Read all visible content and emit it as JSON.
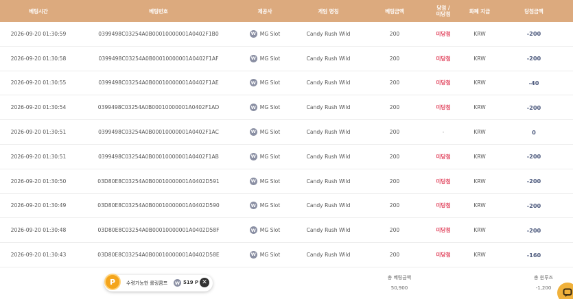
{
  "columns": {
    "time": "베팅시간",
    "id": "베팅번호",
    "vendor": "제공사",
    "game": "게임 명칭",
    "bet": "베팅금액",
    "result_line1": "당첨 /",
    "result_line2": "미당첨",
    "currency": "화폐 지급",
    "win": "당첨금액"
  },
  "rows": [
    {
      "time": "2026-09-20 01:30:59",
      "id": "0399498C03254A0B00010000001A0402F1B0",
      "vendor": "MG Slot",
      "game": "Candy Rush Wild",
      "bet": "200",
      "result": "미당첨",
      "currency": "KRW",
      "win": "-200"
    },
    {
      "time": "2026-09-20 01:30:58",
      "id": "0399498C03254A0B00010000001A0402F1AF",
      "vendor": "MG Slot",
      "game": "Candy Rush Wild",
      "bet": "200",
      "result": "미당첨",
      "currency": "KRW",
      "win": "-200"
    },
    {
      "time": "2026-09-20 01:30:55",
      "id": "0399498C03254A0B00010000001A0402F1AE",
      "vendor": "MG Slot",
      "game": "Candy Rush Wild",
      "bet": "200",
      "result": "미당첨",
      "currency": "KRW",
      "win": "-40"
    },
    {
      "time": "2026-09-20 01:30:54",
      "id": "0399498C03254A0B00010000001A0402F1AD",
      "vendor": "MG Slot",
      "game": "Candy Rush Wild",
      "bet": "200",
      "result": "미당첨",
      "currency": "KRW",
      "win": "-200"
    },
    {
      "time": "2026-09-20 01:30:51",
      "id": "0399498C03254A0B00010000001A0402F1AC",
      "vendor": "MG Slot",
      "game": "Candy Rush Wild",
      "bet": "200",
      "result": "-",
      "currency": "KRW",
      "win": "0"
    },
    {
      "time": "2026-09-20 01:30:51",
      "id": "0399498C03254A0B00010000001A0402F1AB",
      "vendor": "MG Slot",
      "game": "Candy Rush Wild",
      "bet": "200",
      "result": "미당첨",
      "currency": "KRW",
      "win": "-200"
    },
    {
      "time": "2026-09-20 01:30:50",
      "id": "03D80E8C03254A0B00010000001A0402D591",
      "vendor": "MG Slot",
      "game": "Candy Rush Wild",
      "bet": "200",
      "result": "미당첨",
      "currency": "KRW",
      "win": "-200"
    },
    {
      "time": "2026-09-20 01:30:49",
      "id": "03D80E8C03254A0B00010000001A0402D590",
      "vendor": "MG Slot",
      "game": "Candy Rush Wild",
      "bet": "200",
      "result": "미당첨",
      "currency": "KRW",
      "win": "-200"
    },
    {
      "time": "2026-09-20 01:30:48",
      "id": "03D80E8C03254A0B00010000001A0402D58F",
      "vendor": "MG Slot",
      "game": "Candy Rush Wild",
      "bet": "200",
      "result": "미당첨",
      "currency": "KRW",
      "win": "-200"
    },
    {
      "time": "2026-09-20 01:30:43",
      "id": "03D80E8C03254A0B00010000001A0402D58E",
      "vendor": "MG Slot",
      "game": "Candy Rush Wild",
      "bet": "200",
      "result": "미당첨",
      "currency": "KRW",
      "win": "-160"
    }
  ],
  "totals": {
    "bet_label": "총 베팅금액",
    "bet_value": "50,900",
    "win_label": "총 윈루즈",
    "win_value": "-1,200"
  },
  "chip": {
    "badge": "P",
    "text": "수령가능한 롤링콤프",
    "coin": "W",
    "points": "519 P",
    "close": "✕"
  },
  "vendor_icon_letter": "W",
  "colors": {
    "header_bg": "#dcaa7e",
    "lose_text": "#e0415b",
    "win_text": "#4e5b7e",
    "chip_badge": "#f4a51c",
    "chat_button": "#f0b13b"
  }
}
